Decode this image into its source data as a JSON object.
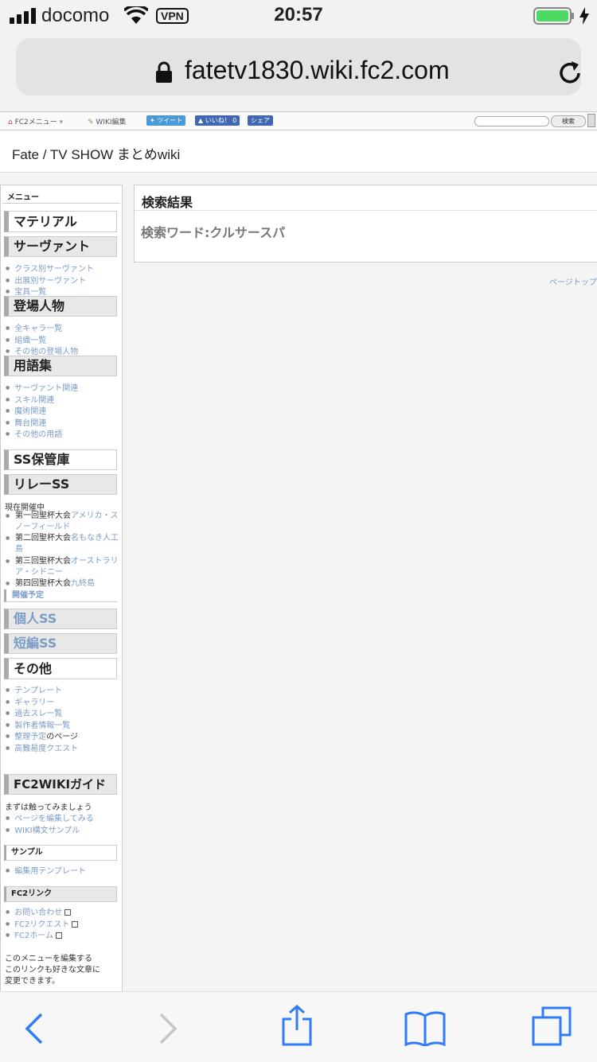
{
  "status": {
    "carrier": "docomo",
    "vpn": "VPN",
    "time": "20:57"
  },
  "browser": {
    "url": "fatetv1830.wiki.fc2.com"
  },
  "fc2bar": {
    "menu": "FC2メニュー",
    "edit": "WIKI編集",
    "tweet": "ツイート",
    "like": "いいね！ 0",
    "share": "シェア",
    "search_button": "検索"
  },
  "site": {
    "title": "Fate / TV SHOW まとめwiki"
  },
  "sidebar": {
    "menu_title": "メニュー",
    "material": "マテリアル",
    "servant": {
      "title": "サーヴァント",
      "links": [
        "クラス別サーヴァント",
        "出展別サーヴァント",
        "宝具一覧"
      ]
    },
    "characters": {
      "title": "登場人物",
      "links": [
        "全キャラ一覧",
        "組織一覧",
        "その他の登場人物"
      ]
    },
    "glossary": {
      "title": "用語集",
      "links": [
        "サーヴァント関連",
        "スキル関連",
        "魔術関連",
        "舞台関連",
        "その他の用語"
      ]
    },
    "ss_archive": "SS保管庫",
    "relay": {
      "title": "リレーSS",
      "current": "現在開催中",
      "entries": [
        {
          "prefix": "第一回聖杯大会",
          "link": "アメリカ・スノーフィールド"
        },
        {
          "prefix": "第二回聖杯大会",
          "link": "名もなき人工島"
        },
        {
          "prefix": "第三回聖杯大会",
          "link": "オーストラリア・シドニー"
        },
        {
          "prefix": "第四回聖杯大会",
          "link": "九終島"
        }
      ],
      "planned": "開催予定"
    },
    "personal_ss": "個人SS",
    "short_ss": "短編SS",
    "other": {
      "title": "その他",
      "links": [
        "テンプレート",
        "ギャラリー",
        "過去スレ一覧",
        "製作者情報一覧",
        "高難易度クエスト"
      ],
      "todo_link": "整理予定",
      "todo_suffix": "のページ"
    },
    "guide": {
      "title": "FC2WIKIガイド",
      "intro": "まずは触ってみましょう",
      "links": [
        "ページを編集してみる",
        "WIKI構文サンプル"
      ]
    },
    "sample": {
      "title": "サンプル",
      "links": [
        "編集用テンプレート"
      ]
    },
    "fc2links": {
      "title": "FC2リンク",
      "links": [
        "お問い合わせ",
        "FC2リクエスト",
        "FC2ホーム"
      ]
    },
    "footer": [
      "このメニューを編集する",
      "このリンクも好きな文章に",
      "変更できます。"
    ]
  },
  "main": {
    "result_title": "検索結果",
    "search_word": "検索ワード:クルサースパ",
    "page_top": "ページトップ"
  }
}
